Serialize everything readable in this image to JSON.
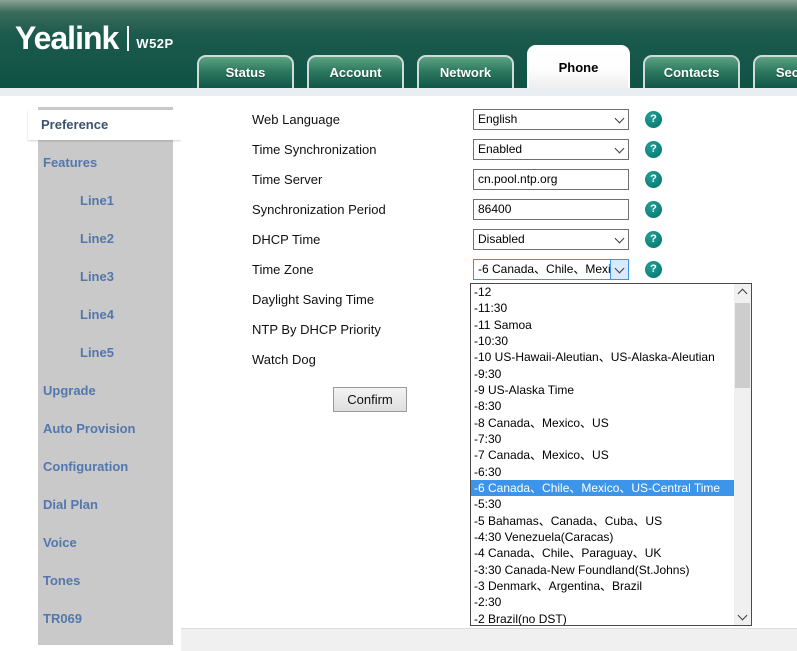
{
  "brand": {
    "name": "Yealink",
    "model": "W52P"
  },
  "tabs": [
    {
      "label": "Status",
      "active": false
    },
    {
      "label": "Account",
      "active": false
    },
    {
      "label": "Network",
      "active": false
    },
    {
      "label": "Phone",
      "active": true
    },
    {
      "label": "Contacts",
      "active": false
    },
    {
      "label": "Security",
      "active": false
    }
  ],
  "sidebar": {
    "items": [
      {
        "label": "Preference",
        "selected": true,
        "indent": false
      },
      {
        "label": "Features",
        "selected": false,
        "indent": false
      },
      {
        "label": "Line1",
        "selected": false,
        "indent": true
      },
      {
        "label": "Line2",
        "selected": false,
        "indent": true
      },
      {
        "label": "Line3",
        "selected": false,
        "indent": true
      },
      {
        "label": "Line4",
        "selected": false,
        "indent": true
      },
      {
        "label": "Line5",
        "selected": false,
        "indent": true
      },
      {
        "label": "Upgrade",
        "selected": false,
        "indent": false
      },
      {
        "label": "Auto Provision",
        "selected": false,
        "indent": false
      },
      {
        "label": "Configuration",
        "selected": false,
        "indent": false
      },
      {
        "label": "Dial Plan",
        "selected": false,
        "indent": false
      },
      {
        "label": "Voice",
        "selected": false,
        "indent": false
      },
      {
        "label": "Tones",
        "selected": false,
        "indent": false
      },
      {
        "label": "TR069",
        "selected": false,
        "indent": false
      }
    ]
  },
  "form": {
    "rows": [
      {
        "label": "Web Language",
        "control": "select",
        "value": "English",
        "help": true
      },
      {
        "label": "Time Synchronization",
        "control": "select",
        "value": "Enabled",
        "help": true
      },
      {
        "label": "Time Server",
        "control": "input",
        "value": "cn.pool.ntp.org",
        "help": true
      },
      {
        "label": "Synchronization Period",
        "control": "input",
        "value": "86400",
        "help": true
      },
      {
        "label": "DHCP Time",
        "control": "select",
        "value": "Disabled",
        "help": true
      },
      {
        "label": "Time Zone",
        "control": "select-open",
        "value": "-6 Canada、Chile、Mexic",
        "help": true
      },
      {
        "label": "Daylight Saving Time",
        "control": "none",
        "value": "",
        "help": false
      },
      {
        "label": "NTP By DHCP Priority",
        "control": "none",
        "value": "",
        "help": false
      },
      {
        "label": "Watch Dog",
        "control": "none",
        "value": "",
        "help": false
      }
    ],
    "confirm_label": "Confirm"
  },
  "timezone_dropdown": {
    "selected_index": 12,
    "options": [
      "-12",
      "-11:30",
      "-11 Samoa",
      "-10:30",
      "-10 US-Hawaii-Aleutian、US-Alaska-Aleutian",
      "-9:30",
      "-9 US-Alaska Time",
      "-8:30",
      "-8 Canada、Mexico、US",
      "-7:30",
      "-7 Canada、Mexico、US",
      "-6:30",
      "-6 Canada、Chile、Mexico、US-Central Time",
      "-5:30",
      "-5 Bahamas、Canada、Cuba、US",
      "-4:30 Venezuela(Caracas)",
      "-4 Canada、Chile、Paraguay、UK",
      "-3:30 Canada-New Foundland(St.Johns)",
      "-3 Denmark、Argentina、Brazil",
      "-2:30",
      "-2 Brazil(no DST)"
    ]
  },
  "icons": {
    "help_icon_glyph": "?",
    "select_chevron": "chevron-down",
    "scroll_up": "chevron-up",
    "scroll_down": "chevron-down"
  },
  "colors": {
    "header_green": "#0f5345",
    "tab_gradient_top": "#5fa183",
    "tab_gradient_bottom": "#115649",
    "sidebar_gray": "#c9c9c9",
    "sidebar_link_blue": "#5377ad",
    "selected_item_text": "#3c5270",
    "highlight_blue": "#3d95e9",
    "help_teal": "#0e8c84",
    "page_bottom_gray": "#f0f0f0"
  }
}
